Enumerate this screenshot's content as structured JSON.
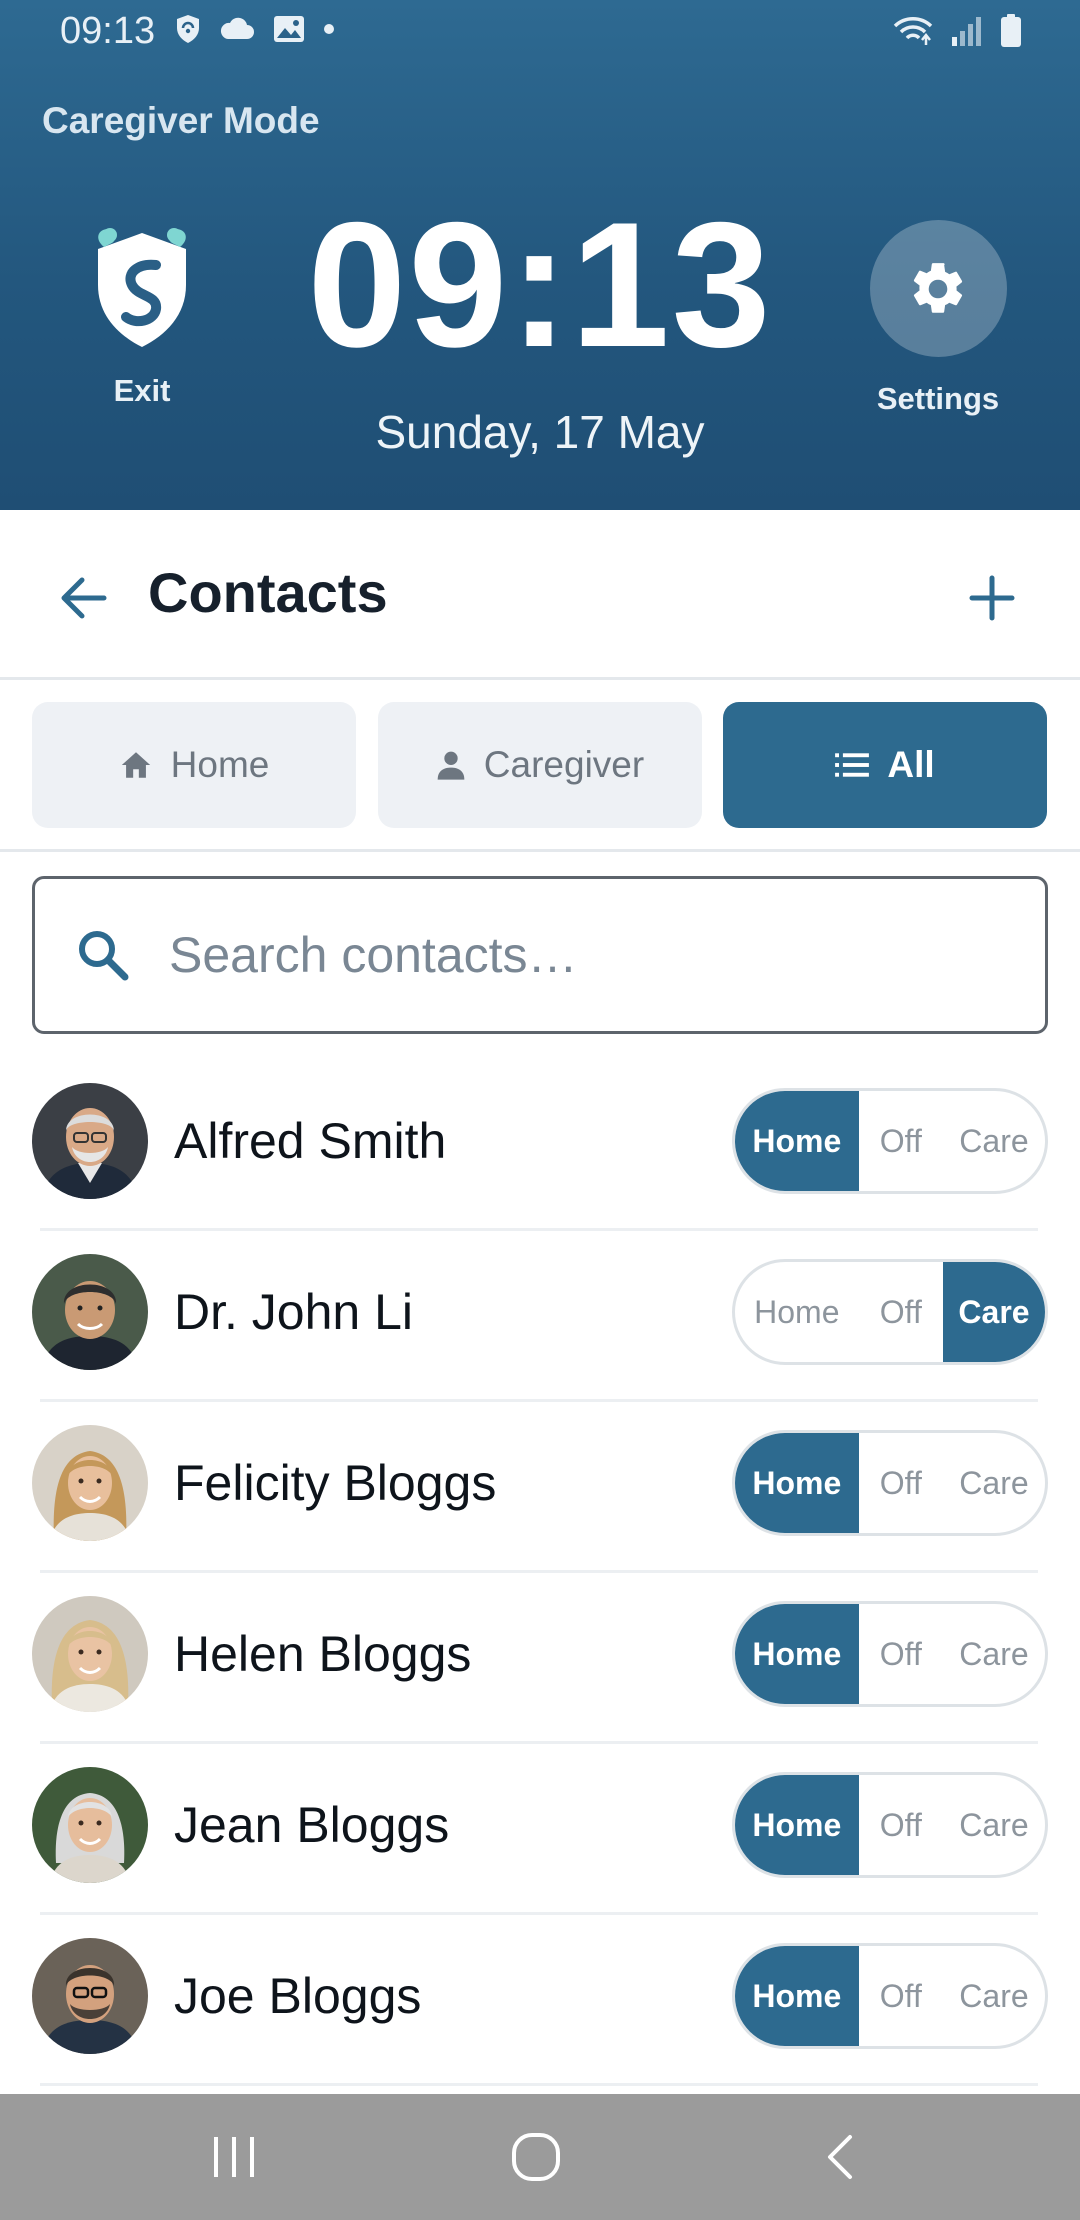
{
  "status_bar": {
    "time": "09:13",
    "left_icons": [
      "vpn-shield-icon",
      "cloud-icon",
      "gallery-icon",
      "dot-icon"
    ],
    "right_icons": [
      "wifi-icon",
      "signal-icon",
      "battery-icon"
    ]
  },
  "header": {
    "mode_label": "Caregiver Mode",
    "exit_label": "Exit",
    "clock": "09:13",
    "date": "Sunday, 17 May",
    "settings_label": "Settings"
  },
  "contacts_bar": {
    "title": "Contacts"
  },
  "tabs": [
    {
      "label": "Home",
      "icon": "home-icon",
      "active": false
    },
    {
      "label": "Caregiver",
      "icon": "person-icon",
      "active": false
    },
    {
      "label": "All",
      "icon": "list-icon",
      "active": true
    }
  ],
  "search": {
    "placeholder": "Search contacts…",
    "value": ""
  },
  "segment_labels": {
    "home": "Home",
    "off": "Off",
    "care": "Care"
  },
  "contacts": [
    {
      "name": "Alfred Smith",
      "mode": "home"
    },
    {
      "name": "Dr. John Li",
      "mode": "care"
    },
    {
      "name": "Felicity Bloggs",
      "mode": "home"
    },
    {
      "name": "Helen Bloggs",
      "mode": "home"
    },
    {
      "name": "Jean Bloggs",
      "mode": "home"
    },
    {
      "name": "Joe Bloggs",
      "mode": "home"
    }
  ],
  "colors": {
    "header_top": "#2e6a92",
    "header_bottom": "#1f4e74",
    "accent": "#2d6a8f",
    "logo_teal": "#7fd6d2",
    "navbar": "#9b9b9b"
  },
  "navbar": {
    "buttons": [
      "recents-icon",
      "home-circle-icon",
      "back-chevron-icon"
    ]
  }
}
